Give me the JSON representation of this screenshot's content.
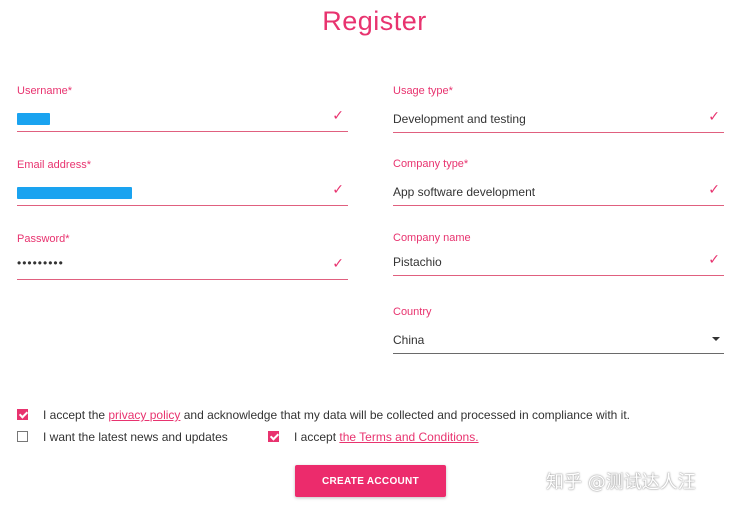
{
  "title": "Register",
  "left_form": {
    "username": {
      "label": "Username*",
      "check": "✓"
    },
    "email": {
      "label": "Email address*",
      "check": "✓"
    },
    "password": {
      "label": "Password*",
      "value": "•••••••••",
      "check": "✓"
    }
  },
  "right_form": {
    "usage_type": {
      "label": "Usage type*",
      "value": "Development and testing",
      "check": "✓"
    },
    "company_type": {
      "label": "Company type*",
      "value": "App software development",
      "check": "✓"
    },
    "company_name": {
      "label": "Company name",
      "value": "Pistachio",
      "check": "✓"
    },
    "country": {
      "label": "Country",
      "value": "China"
    }
  },
  "consents": {
    "privacy": {
      "checked": true,
      "prefix": "I accept the ",
      "link": "privacy policy",
      "suffix": " and acknowledge that my data will be collected and processed in compliance with it."
    },
    "news": {
      "checked": false,
      "text": "I want the latest news and updates"
    },
    "terms": {
      "checked": true,
      "prefix": "I accept ",
      "link": "the Terms and Conditions."
    }
  },
  "create_button": "CREATE ACCOUNT",
  "watermark": "知乎 @测试达人汪",
  "colors": {
    "accent": "#e8336f",
    "button": "#ec2b6c",
    "masked_value": "#1aa3f0"
  }
}
